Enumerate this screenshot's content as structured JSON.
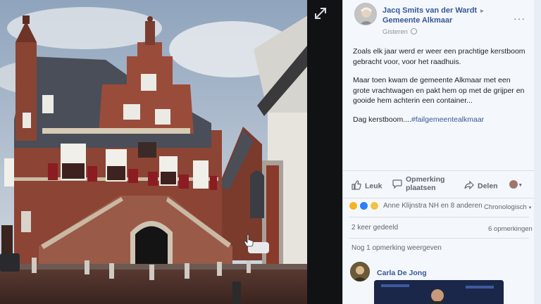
{
  "post": {
    "author_name": "Jacq Smits van der Wardt",
    "author_arrow": "▸",
    "group_name": "Gemeente Alkmaar",
    "timestamp": "Gisteren",
    "more_label": "···",
    "paragraphs": [
      "Zoals elk jaar werd er weer een prachtige kerstboom gebracht voor, voor het raadhuis.",
      "Maar toen kwam de gemeente Alkmaar met een grote vrachtwagen en pakt hem op met de grijper en gooide hem achterin een container..."
    ],
    "last_line_prefix": "Dag kerstboom....",
    "hashtag": "#failgemeentealkmaar"
  },
  "actions": {
    "like": "Leuk",
    "comment_line1": "Opmerking",
    "comment_line2": "plaatsen",
    "share": "Delen"
  },
  "stats": {
    "reactions_text": "Anne Klijnstra NH en 8 anderen",
    "sort_label": "Chronologisch",
    "shares_text": "2 keer gedeeld",
    "comments_text": "6 opmerkingen",
    "view_more": "Nog 1 opmerking weergeven"
  },
  "comment": {
    "author": "Carla De Jong"
  },
  "colors": {
    "link": "#365899",
    "secondary": "#606770",
    "panel_bg": "#f4f7fb"
  },
  "icons": {
    "expand": "expand-icon",
    "like": "thumbs-up-icon",
    "comment": "speech-bubble-icon",
    "share": "share-arrow-icon"
  }
}
